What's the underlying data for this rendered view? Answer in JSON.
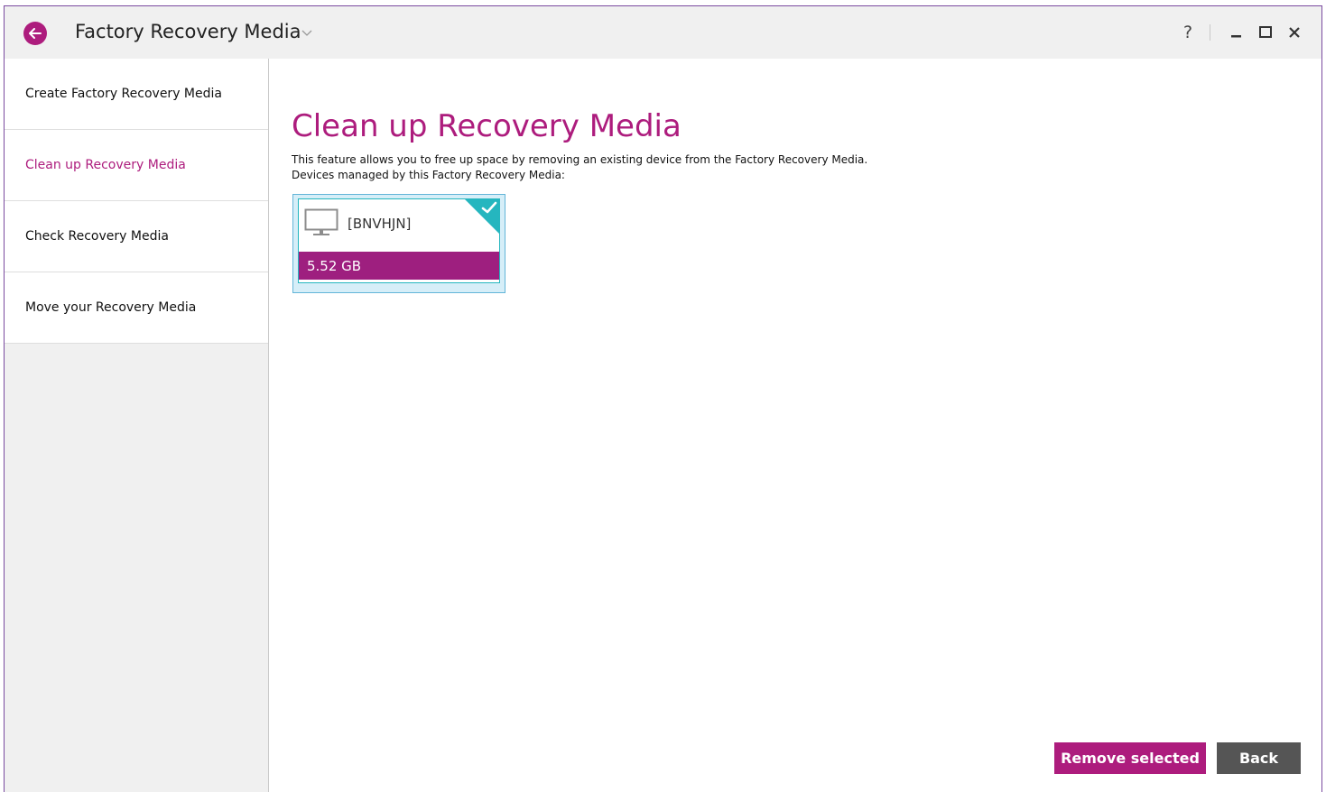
{
  "window": {
    "title": "Factory Recovery Media",
    "help_label": "?",
    "accent_color": "#ad1c7d"
  },
  "sidebar": {
    "items": [
      {
        "label": "Create Factory Recovery Media"
      },
      {
        "label": "Clean up Recovery Media"
      },
      {
        "label": "Check Recovery Media"
      },
      {
        "label": "Move your Recovery Media"
      }
    ],
    "active_index": 1
  },
  "main": {
    "title": "Clean up Recovery Media",
    "description": [
      "This feature allows you to free up space by removing an existing device from the Factory Recovery Media.",
      "Devices managed by this Factory Recovery Media:"
    ],
    "devices": [
      {
        "name": "[BNVHJN]",
        "size": "5.52 GB",
        "selected": true,
        "icon": "monitor-icon"
      }
    ]
  },
  "buttons": {
    "remove_label": "Remove selected",
    "back_label": "Back"
  }
}
